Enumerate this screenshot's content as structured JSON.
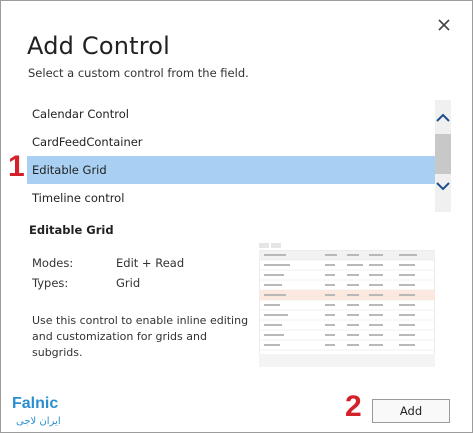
{
  "dialog": {
    "title": "Add Control",
    "subtitle": "Select a custom control from the field."
  },
  "list": {
    "items": [
      {
        "label": "Calendar Control"
      },
      {
        "label": "CardFeedContainer"
      },
      {
        "label": "Editable Grid",
        "selected": true
      },
      {
        "label": "Timeline control"
      }
    ]
  },
  "detail": {
    "title": "Editable Grid",
    "modes_label": "Modes:",
    "modes_value": "Edit + Read",
    "types_label": "Types:",
    "types_value": "Grid",
    "description": "Use this control to enable inline editing and customization for grids and subgrids."
  },
  "buttons": {
    "add": "Add"
  },
  "annotations": {
    "one": "1",
    "two": "2"
  },
  "logo": {
    "text_main": "Falnic",
    "text_sub": "ایران لاجی"
  },
  "colors": {
    "selection": "#a9d0f2",
    "annotation": "#d3202a",
    "logo_blue": "#2a8fcf"
  }
}
